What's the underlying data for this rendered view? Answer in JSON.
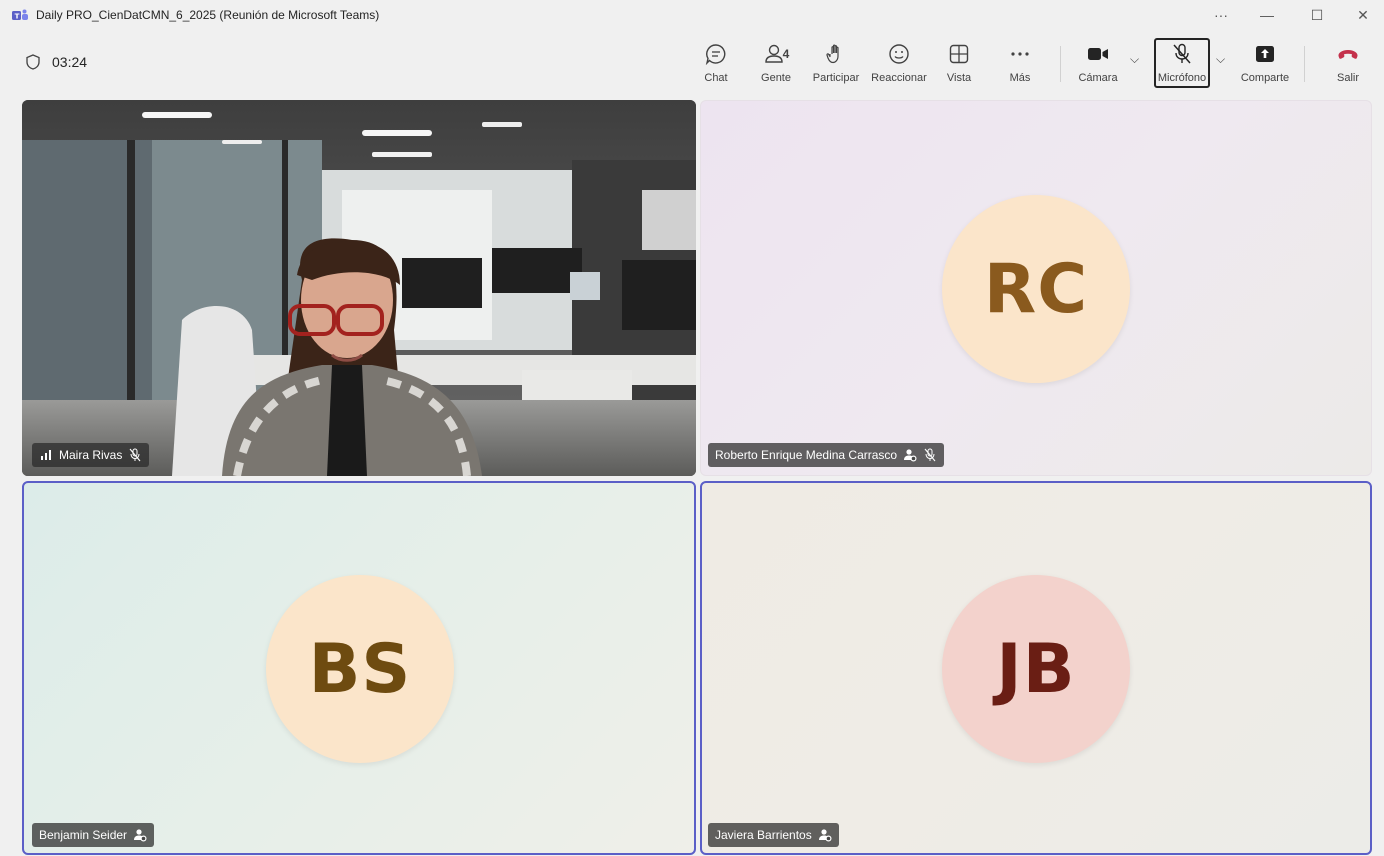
{
  "window": {
    "title": "Daily PRO_CienDatCMN_6_2025 (Reunión de Microsoft Teams)",
    "more": "···",
    "minimize": "—",
    "maximize": "☐",
    "close": "✕"
  },
  "meeting": {
    "timer": "03:24"
  },
  "toolbar": {
    "chat": "Chat",
    "people": "Gente",
    "people_count": "4",
    "raise_hand": "Participar",
    "react": "Reaccionar",
    "view": "Vista",
    "more": "Más",
    "camera": "Cámara",
    "microphone": "Micrófono",
    "share": "Comparte",
    "leave": "Salir"
  },
  "colors": {
    "accent": "#5b5fc7",
    "leave": "#c4314b"
  },
  "participants": [
    {
      "name": "Maira Rivas",
      "video": true,
      "muted": true
    },
    {
      "name": "Roberto Enrique Medina Carrasco",
      "initials": "RC",
      "muted": true
    },
    {
      "name": "Benjamin Seider",
      "initials": "BS"
    },
    {
      "name": "Javiera Barrientos",
      "initials": "JB"
    }
  ]
}
